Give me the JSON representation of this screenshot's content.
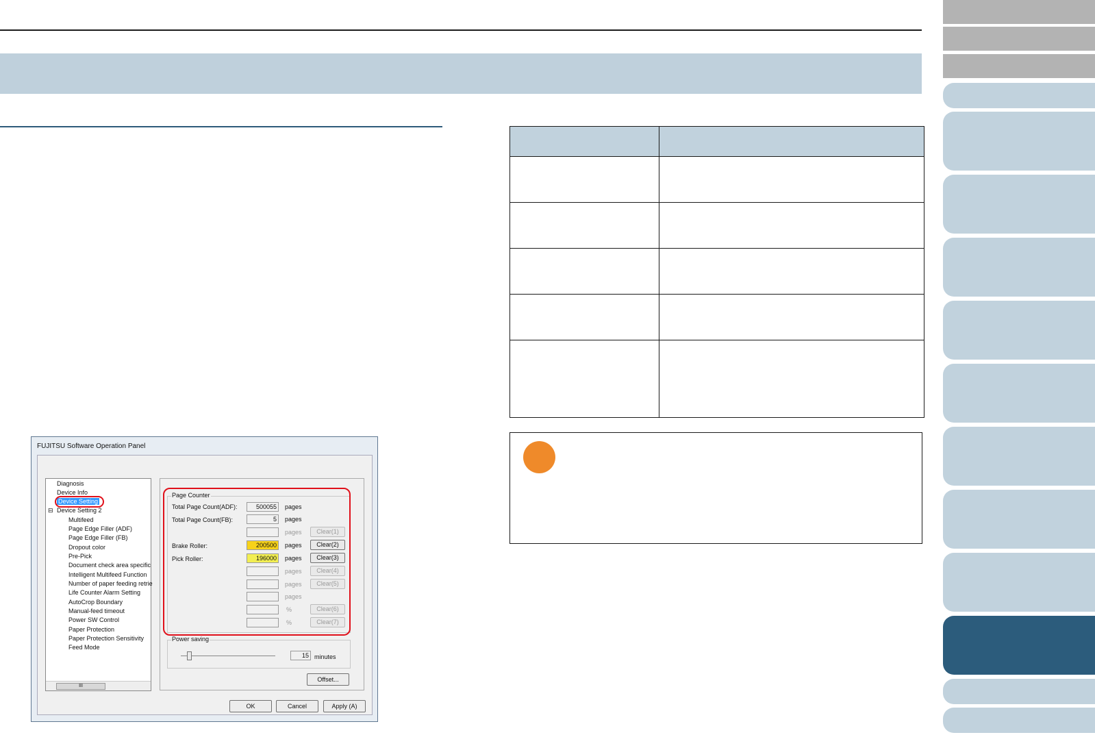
{
  "dialog": {
    "title": "FUJITSU Software Operation Panel",
    "tree": {
      "items": [
        "Diagnosis",
        "Device Info",
        "Device Setting",
        "Device Setting 2",
        "Multifeed",
        "Page Edge Filler (ADF)",
        "Page Edge Filler (FB)",
        "Dropout color",
        "Pre-Pick",
        "Document check area specific",
        "Intelligent Multifeed Function",
        "Number of paper feeding retrie",
        "Life Counter Alarm Setting",
        "AutoCrop Boundary",
        "Manual-feed timeout",
        "Power SW Control",
        "Paper Protection",
        "Paper Protection Sensitivity",
        "Feed Mode"
      ],
      "scroll_thumb": "III"
    },
    "page_counter": {
      "group_label": "Page Counter",
      "total_adf_label": "Total Page Count(ADF):",
      "total_adf_value": "500055",
      "total_fb_label": "Total Page Count(FB):",
      "total_fb_value": "5",
      "brake_label": "Brake Roller:",
      "brake_value": "200500",
      "pick_label": "Pick Roller:",
      "pick_value": "196000",
      "pages": "pages",
      "percent": "%",
      "clear1": "Clear(1)",
      "clear2": "Clear(2)",
      "clear3": "Clear(3)",
      "clear4": "Clear(4)",
      "clear5": "Clear(5)",
      "clear6": "Clear(6)",
      "clear7": "Clear(7)"
    },
    "power_saving": {
      "group_label": "Power saving",
      "value": "15",
      "unit": "minutes"
    },
    "offset_button": "Offset...",
    "ok_button": "OK",
    "cancel_button": "Cancel",
    "apply_button": "Apply (A)"
  },
  "colors": {
    "banner": "#bfd0dc",
    "tab_blue": "#c1d2dd",
    "tab_active": "#2c5c7c",
    "note_circle": "#ef8a2a",
    "highlight_red": "#e0101a"
  }
}
